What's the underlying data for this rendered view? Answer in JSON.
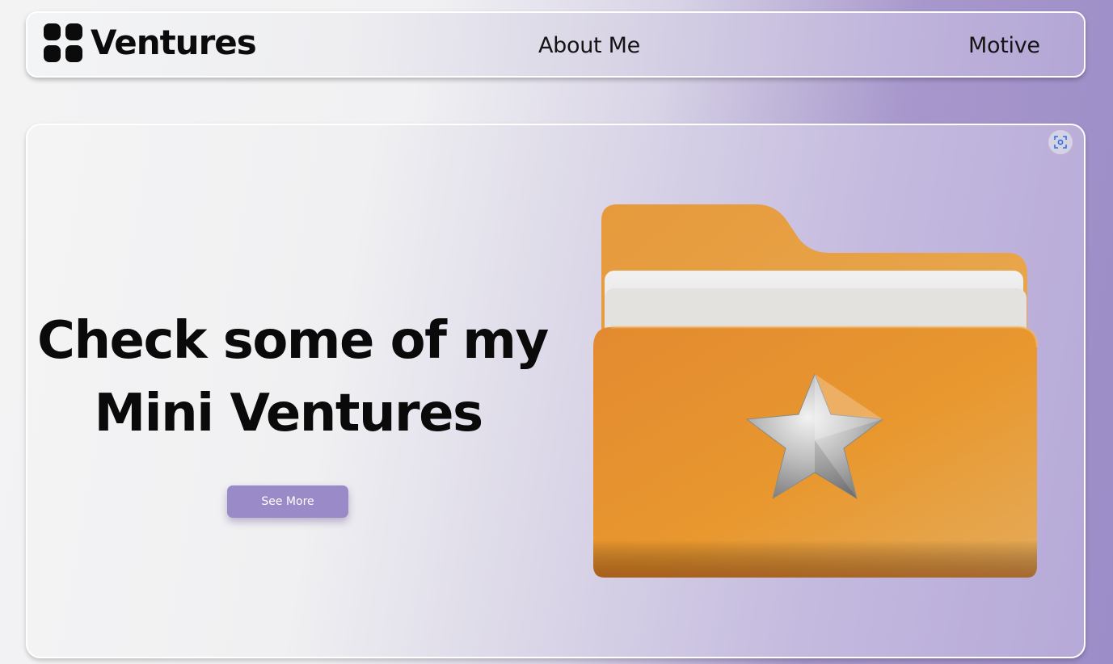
{
  "nav": {
    "logo_text": "Ventures",
    "links": [
      "About Me",
      "Motive"
    ]
  },
  "hero": {
    "line1": "Check some of my",
    "line2": "Mini Ventures",
    "button_label": "See More"
  },
  "icons": {
    "logo": "four-dots-grid-icon",
    "corner": "screenshot-scan-icon",
    "illustration": "folder-star-icon"
  },
  "colors": {
    "accent": "#9a8ac7",
    "folder": "#e8962f",
    "text": "#0a0a0a"
  }
}
